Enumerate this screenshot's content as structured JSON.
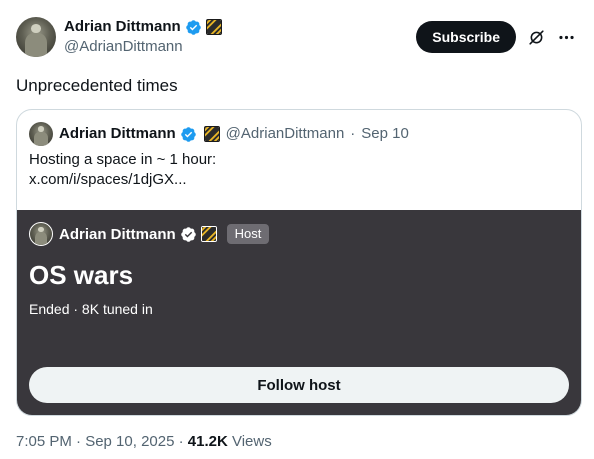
{
  "author": {
    "name": "Adrian Dittmann",
    "handle": "@AdrianDittmann",
    "avatar_icon": "profile-photo"
  },
  "actions": {
    "subscribe_label": "Subscribe",
    "grok_icon": "grok-icon",
    "more_icon": "more-icon"
  },
  "tweet": {
    "text": "Unprecedented times"
  },
  "quote": {
    "name": "Adrian Dittmann",
    "handle": "@AdrianDittmann",
    "separator": "·",
    "date": "Sep 10",
    "line1": "Hosting a space in ~ 1 hour:",
    "line2": "x.com/i/spaces/1djGX..."
  },
  "space": {
    "host_name": "Adrian Dittmann",
    "host_label": "Host",
    "title": "OS wars",
    "meta": "Ended · 8K tuned in",
    "follow_label": "Follow host",
    "background_color": "#39373c"
  },
  "footer": {
    "timestamp": "7:05 PM · Sep 10, 2025 · ",
    "views_count": "41.2K",
    "views_label": " Views"
  },
  "colors": {
    "verified_blue": "#1d9bf0",
    "text_primary": "#0f1419",
    "text_secondary": "#536471"
  }
}
